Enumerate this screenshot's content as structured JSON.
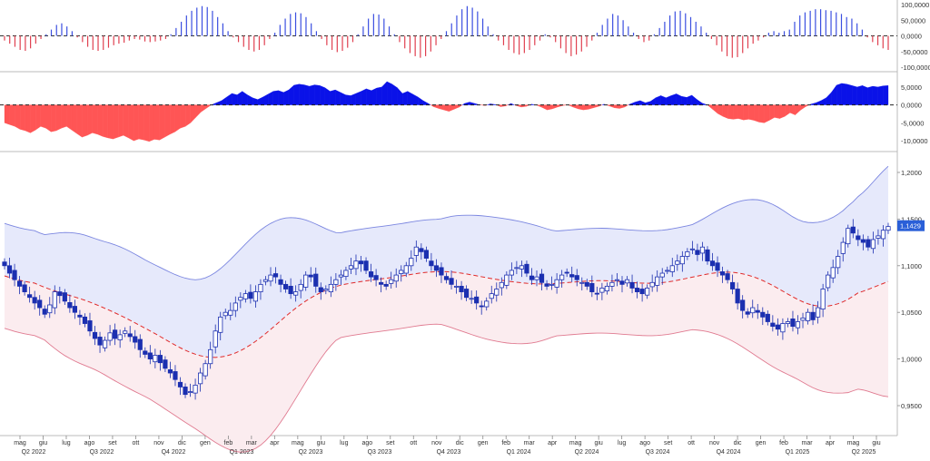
{
  "colors": {
    "bull": "#1b2fb0",
    "bear": "#1b2fb0",
    "hist_pos": "#3b4fe0",
    "hist_neg": "#e04050",
    "area_pos": "#0a12e8",
    "area_neg": "#ff5555",
    "band_line": "#7b86e0",
    "band_fill_upper": "#e6e9fb",
    "band_fill_lower": "#fbecef",
    "lower_line": "#e07a90",
    "mid_line": "#e02a2a",
    "grid": "#cccccc",
    "last_price_bg": "#2a5fd8"
  },
  "chart_data": [
    {
      "type": "bar",
      "panel": "oscillator-top",
      "ylim": [
        -100000,
        100000
      ],
      "y_ticks": [
        "100,0000",
        "50,0000",
        "0,0000",
        "-50,0000",
        "-100,0000"
      ],
      "y_tick_values": [
        100000,
        50000,
        0,
        -50000,
        -100000
      ],
      "values": [
        -15000,
        -25000,
        -35000,
        -45000,
        -48000,
        -40000,
        -25000,
        -10000,
        5000,
        20000,
        35000,
        40000,
        30000,
        15000,
        -5000,
        -20000,
        -35000,
        -45000,
        -48000,
        -45000,
        -38000,
        -30000,
        -25000,
        -22000,
        -15000,
        -10000,
        -12000,
        -18000,
        -20000,
        -18000,
        -15000,
        -10000,
        5000,
        25000,
        45000,
        65000,
        80000,
        90000,
        95000,
        92000,
        80000,
        60000,
        40000,
        15000,
        -5000,
        -20000,
        -35000,
        -45000,
        -50000,
        -45000,
        -30000,
        -10000,
        10000,
        35000,
        55000,
        70000,
        75000,
        72000,
        60000,
        40000,
        15000,
        -10000,
        -30000,
        -45000,
        -52000,
        -48000,
        -38000,
        -20000,
        5000,
        30000,
        55000,
        70000,
        68000,
        55000,
        30000,
        5000,
        -20000,
        -40000,
        -55000,
        -65000,
        -70000,
        -65000,
        -50000,
        -30000,
        -10000,
        15000,
        40000,
        65000,
        85000,
        95000,
        90000,
        78000,
        55000,
        30000,
        5000,
        -15000,
        -30000,
        -45000,
        -55000,
        -60000,
        -55000,
        -45000,
        -30000,
        -15000,
        5000,
        -5000,
        -20000,
        -40000,
        -55000,
        -65000,
        -60000,
        -50000,
        -35000,
        -15000,
        10000,
        35000,
        55000,
        70000,
        65000,
        50000,
        30000,
        10000,
        -10000,
        -20000,
        -15000,
        5000,
        25000,
        45000,
        65000,
        78000,
        80000,
        72000,
        60000,
        45000,
        30000,
        10000,
        -10000,
        -30000,
        -50000,
        -65000,
        -70000,
        -68000,
        -55000,
        -40000,
        -25000,
        -15000,
        -5000,
        10000,
        15000,
        10000,
        15000,
        20000,
        45000,
        65000,
        75000,
        80000,
        85000,
        85000,
        82000,
        80000,
        75000,
        70000,
        60000,
        55000,
        40000,
        20000,
        -5000,
        -20000,
        -30000,
        -40000,
        -45000
      ]
    },
    {
      "type": "area",
      "panel": "oscillator-mid",
      "ylim": [
        -12000,
        8000
      ],
      "y_ticks": [
        "5,0000",
        "0,0000",
        "-5,0000",
        "-10,0000"
      ],
      "y_tick_values": [
        5000,
        0,
        -5000,
        -10000
      ],
      "values": [
        -5000,
        -5500,
        -6000,
        -6800,
        -7200,
        -7800,
        -7000,
        -6000,
        -6500,
        -7500,
        -7200,
        -6500,
        -6000,
        -7000,
        -8000,
        -9000,
        -8500,
        -7800,
        -8200,
        -8800,
        -9200,
        -9500,
        -9000,
        -8500,
        -9200,
        -10000,
        -9500,
        -9800,
        -10200,
        -9600,
        -9800,
        -9000,
        -8200,
        -7500,
        -6500,
        -6000,
        -5000,
        -3500,
        -2000,
        -1000,
        0,
        600,
        1200,
        2200,
        3200,
        2800,
        3800,
        2800,
        2000,
        1500,
        2200,
        3000,
        3800,
        4000,
        3500,
        4200,
        5500,
        5800,
        5600,
        5200,
        5600,
        5400,
        4800,
        3800,
        4200,
        3500,
        2800,
        2600,
        3200,
        3800,
        4500,
        4000,
        4700,
        5000,
        6500,
        5800,
        4800,
        3200,
        3800,
        3000,
        2200,
        1200,
        400,
        -500,
        -1000,
        -1400,
        -1800,
        -1200,
        -600,
        400,
        800,
        400,
        0,
        -200,
        300,
        100,
        -500,
        -300,
        400,
        -200,
        -600,
        -400,
        200,
        -100,
        -700,
        -1400,
        -1100,
        -600,
        -200,
        0,
        -600,
        -1100,
        -1400,
        -1200,
        -800,
        -400,
        200,
        -300,
        -800,
        -1000,
        -600,
        200,
        800,
        1200,
        600,
        1000,
        2000,
        2600,
        2000,
        2600,
        3100,
        2400,
        2100,
        2700,
        1500,
        500,
        0,
        -1200,
        -2400,
        -3200,
        -3800,
        -4000,
        -3800,
        -4200,
        -4000,
        -4300,
        -4800,
        -5000,
        -4300,
        -3500,
        -3800,
        -3200,
        -2200,
        -2800,
        -1500,
        -500,
        200,
        600,
        1200,
        2000,
        3500,
        5500,
        6000,
        5800,
        5400,
        5000,
        5400,
        4800,
        5200,
        5000,
        5300,
        5400
      ]
    },
    {
      "type": "candlestick",
      "panel": "price",
      "ylim": [
        0.92,
        1.22
      ],
      "y_ticks": [
        "1,2000",
        "1,1500",
        "1,1000",
        "1,0500",
        "1,0000",
        "0,9500"
      ],
      "y_tick_values": [
        1.2,
        1.15,
        1.1,
        1.05,
        1.0,
        0.95
      ],
      "last_price_label": "1,1429",
      "last_price": 1.1429,
      "x_month_labels": [
        "mag",
        "giu",
        "lug",
        "ago",
        "set",
        "ott",
        "nov",
        "dic",
        "gen",
        "feb",
        "mar",
        "apr",
        "mag",
        "giu",
        "lug",
        "ago",
        "set",
        "ott",
        "nov",
        "dic",
        "gen",
        "feb",
        "mar",
        "apr",
        "mag",
        "giu",
        "lug",
        "ago",
        "set",
        "ott",
        "nov",
        "dic",
        "gen",
        "feb",
        "mar",
        "apr",
        "mag",
        "giu"
      ],
      "x_quarter_labels": [
        "Q2 2022",
        "Q3 2022",
        "Q4 2022",
        "Q1 2023",
        "Q2 2023",
        "Q3 2023",
        "Q4 2023",
        "Q1 2024",
        "Q2 2024",
        "Q3 2024",
        "Q4 2024",
        "Q1 2025",
        "Q2 2025"
      ],
      "closes": [
        1.1,
        1.092,
        1.085,
        1.078,
        1.072,
        1.066,
        1.06,
        1.055,
        1.048,
        1.058,
        1.072,
        1.068,
        1.062,
        1.055,
        1.05,
        1.045,
        1.038,
        1.03,
        1.022,
        1.015,
        1.02,
        1.028,
        1.022,
        1.026,
        1.03,
        1.024,
        1.018,
        1.01,
        1.005,
        1.0,
        1.004,
        0.996,
        0.99,
        0.985,
        0.978,
        0.97,
        0.962,
        0.965,
        0.972,
        0.985,
        0.995,
        1.01,
        1.03,
        1.045,
        1.05,
        1.052,
        1.06,
        1.066,
        1.07,
        1.065,
        1.072,
        1.08,
        1.085,
        1.09,
        1.088,
        1.08,
        1.075,
        1.07,
        1.072,
        1.08,
        1.09,
        1.088,
        1.078,
        1.072,
        1.075,
        1.08,
        1.085,
        1.09,
        1.095,
        1.1,
        1.105,
        1.102,
        1.095,
        1.088,
        1.085,
        1.08,
        1.078,
        1.085,
        1.09,
        1.095,
        1.1,
        1.108,
        1.12,
        1.115,
        1.108,
        1.1,
        1.095,
        1.09,
        1.085,
        1.08,
        1.078,
        1.072,
        1.066,
        1.065,
        1.06,
        1.056,
        1.062,
        1.07,
        1.075,
        1.082,
        1.09,
        1.095,
        1.098,
        1.1,
        1.092,
        1.085,
        1.088,
        1.082,
        1.078,
        1.08,
        1.085,
        1.09,
        1.092,
        1.088,
        1.085,
        1.082,
        1.078,
        1.072,
        1.07,
        1.076,
        1.078,
        1.082,
        1.085,
        1.08,
        1.085,
        1.076,
        1.072,
        1.07,
        1.076,
        1.082,
        1.088,
        1.092,
        1.095,
        1.1,
        1.105,
        1.11,
        1.115,
        1.118,
        1.112,
        1.12,
        1.105,
        1.1,
        1.095,
        1.09,
        1.085,
        1.075,
        1.06,
        1.052,
        1.048,
        1.055,
        1.05,
        1.045,
        1.04,
        1.035,
        1.032,
        1.038,
        1.04,
        1.035,
        1.04,
        1.044,
        1.05,
        1.042,
        1.055,
        1.075,
        1.09,
        1.098,
        1.11,
        1.125,
        1.14,
        1.135,
        1.128,
        1.125,
        1.12,
        1.128,
        1.132,
        1.138,
        1.142
      ]
    }
  ]
}
